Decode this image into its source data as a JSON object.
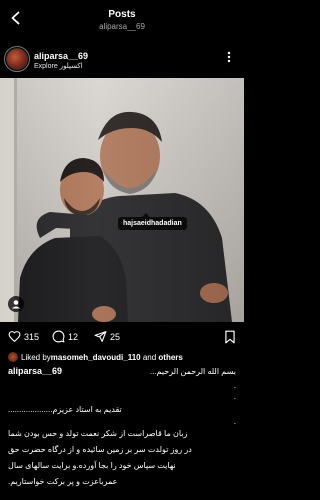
{
  "header": {
    "title": "Posts",
    "subtitle": "aliparsa__69"
  },
  "post": {
    "username": "aliparsa__69",
    "location": "Explore اکسپلور",
    "tag": "hajsaeidhadadian",
    "likes": "315",
    "comments": "12",
    "shares": "25",
    "liked_by_prefix": "Liked by ",
    "liked_by_user": "masomeh_davoudi_110",
    "liked_by_and": " and ",
    "liked_by_others": "others",
    "caption_username": "aliparsa__69",
    "caption_lines": [
      "بسم الله الرحمن الرحیم...",
      ".",
      ".",
      "تقدیم به استاد عزیزم....................",
      ".",
      "زبان ما قاصراست از شکر نعمت تولد و حس بودن شما",
      "در روز تولدت سر بر زمین سائیده و از درگاه حضرت حق",
      "نهایت سپاس خود را بجا آورده.و برایت سالهای سال",
      "عمرباعزت و پر برکت خواستاریم."
    ]
  },
  "colors": {
    "background": "#000000",
    "text": "#ffffff",
    "muted": "#a8a8a8"
  },
  "icons": {
    "back": "chevron-left-icon",
    "more": "more-dots-icon",
    "like": "heart-icon",
    "comment": "comment-icon",
    "share": "share-icon",
    "save": "bookmark-icon",
    "tagged_user": "user-tag-icon"
  }
}
